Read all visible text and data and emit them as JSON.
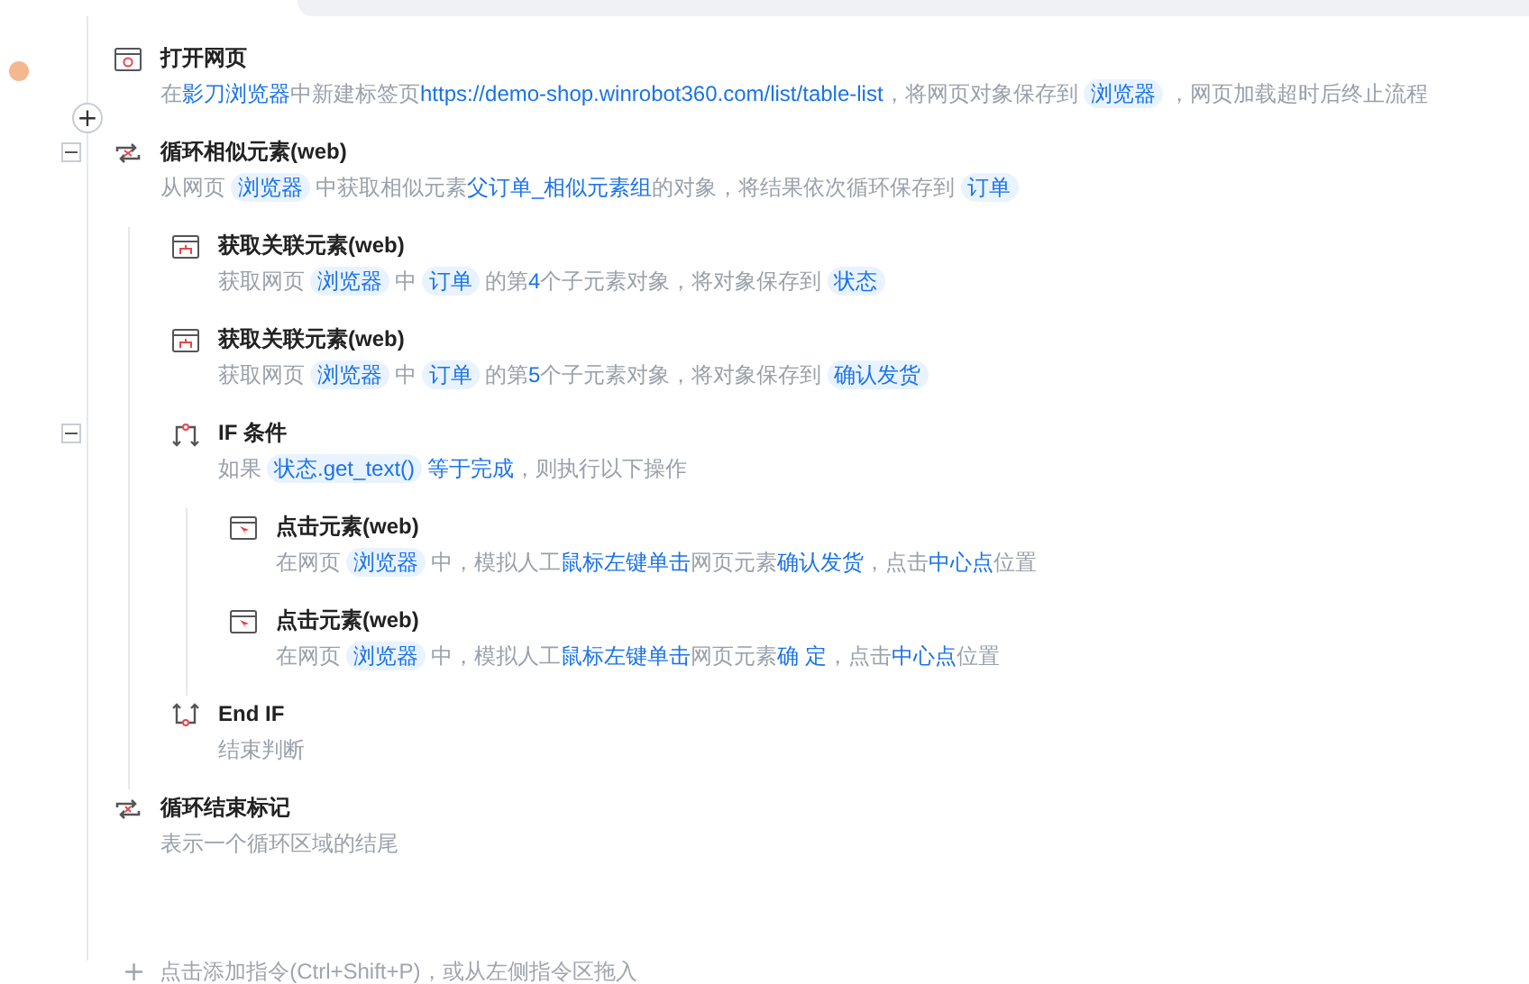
{
  "steps": [
    {
      "kind": "browser",
      "title": "打开网页",
      "breakpoint": true,
      "description": [
        {
          "kind": "plain",
          "text": "在"
        },
        {
          "kind": "link",
          "text": "影刀浏览器"
        },
        {
          "kind": "plain",
          "text": "中新建标签页"
        },
        {
          "kind": "link",
          "text": "https://demo-shop.winrobot360.com/list/table-list"
        },
        {
          "kind": "plain",
          "text": "，将网页对象保存到"
        },
        {
          "kind": "var",
          "text": "浏览器"
        },
        {
          "kind": "plain",
          "text": "，网页加载超时后终止流程"
        }
      ]
    },
    {
      "kind": "loop",
      "title": "循环相似元素(web)",
      "expanded": true,
      "description": [
        {
          "kind": "plain",
          "text": "从网页"
        },
        {
          "kind": "var",
          "text": "浏览器"
        },
        {
          "kind": "plain",
          "text": "中获取相似元素"
        },
        {
          "kind": "link",
          "text": "父订单_相似元素组"
        },
        {
          "kind": "plain",
          "text": "的对象，将结果依次循环保存到"
        },
        {
          "kind": "var",
          "text": "订单"
        }
      ],
      "children": [
        {
          "kind": "relate",
          "title": "获取关联元素(web)",
          "description": [
            {
              "kind": "plain",
              "text": "获取网页"
            },
            {
              "kind": "var",
              "text": "浏览器"
            },
            {
              "kind": "plain",
              "text": "中"
            },
            {
              "kind": "var",
              "text": "订单"
            },
            {
              "kind": "plain",
              "text": "的第"
            },
            {
              "kind": "link",
              "text": "4"
            },
            {
              "kind": "plain",
              "text": "个子元素对象，将对象保存到"
            },
            {
              "kind": "var",
              "text": "状态"
            }
          ]
        },
        {
          "kind": "relate",
          "title": "获取关联元素(web)",
          "description": [
            {
              "kind": "plain",
              "text": "获取网页"
            },
            {
              "kind": "var",
              "text": "浏览器"
            },
            {
              "kind": "plain",
              "text": "中"
            },
            {
              "kind": "var",
              "text": "订单"
            },
            {
              "kind": "plain",
              "text": "的第"
            },
            {
              "kind": "link",
              "text": "5"
            },
            {
              "kind": "plain",
              "text": "个子元素对象，将对象保存到"
            },
            {
              "kind": "var",
              "text": "确认发货"
            }
          ]
        },
        {
          "kind": "if",
          "title": "IF 条件",
          "expanded": true,
          "description": [
            {
              "kind": "plain",
              "text": "如果"
            },
            {
              "kind": "var",
              "text": "状态.get_text()"
            },
            {
              "kind": "link",
              "text": "等于完成"
            },
            {
              "kind": "plain",
              "text": "，则执行以下操作"
            }
          ],
          "children": [
            {
              "kind": "click",
              "title": "点击元素(web)",
              "description": [
                {
                  "kind": "plain",
                  "text": "在网页"
                },
                {
                  "kind": "var",
                  "text": "浏览器"
                },
                {
                  "kind": "plain",
                  "text": "中，模拟人工"
                },
                {
                  "kind": "link",
                  "text": "鼠标左键单击"
                },
                {
                  "kind": "plain",
                  "text": "网页元素"
                },
                {
                  "kind": "link",
                  "text": "确认发货"
                },
                {
                  "kind": "plain",
                  "text": "，点击"
                },
                {
                  "kind": "link",
                  "text": "中心点"
                },
                {
                  "kind": "plain",
                  "text": "位置"
                }
              ]
            },
            {
              "kind": "click",
              "title": "点击元素(web)",
              "description": [
                {
                  "kind": "plain",
                  "text": "在网页"
                },
                {
                  "kind": "var",
                  "text": "浏览器"
                },
                {
                  "kind": "plain",
                  "text": "中，模拟人工"
                },
                {
                  "kind": "link",
                  "text": "鼠标左键单击"
                },
                {
                  "kind": "plain",
                  "text": "网页元素"
                },
                {
                  "kind": "link",
                  "text": "确 定"
                },
                {
                  "kind": "plain",
                  "text": "，点击"
                },
                {
                  "kind": "link",
                  "text": "中心点"
                },
                {
                  "kind": "plain",
                  "text": "位置"
                }
              ]
            }
          ]
        },
        {
          "kind": "endif",
          "title": "End IF",
          "description": [
            {
              "kind": "plain",
              "text": "结束判断"
            }
          ]
        }
      ]
    },
    {
      "kind": "loopend",
      "title": "循环结束标记",
      "description": [
        {
          "kind": "plain",
          "text": "表示一个循环区域的结尾"
        }
      ]
    }
  ],
  "add_hint": {
    "icon": "+",
    "text": "点击添加指令(Ctrl+Shift+P)，或从左侧指令区拖入"
  },
  "insert_button": "+"
}
